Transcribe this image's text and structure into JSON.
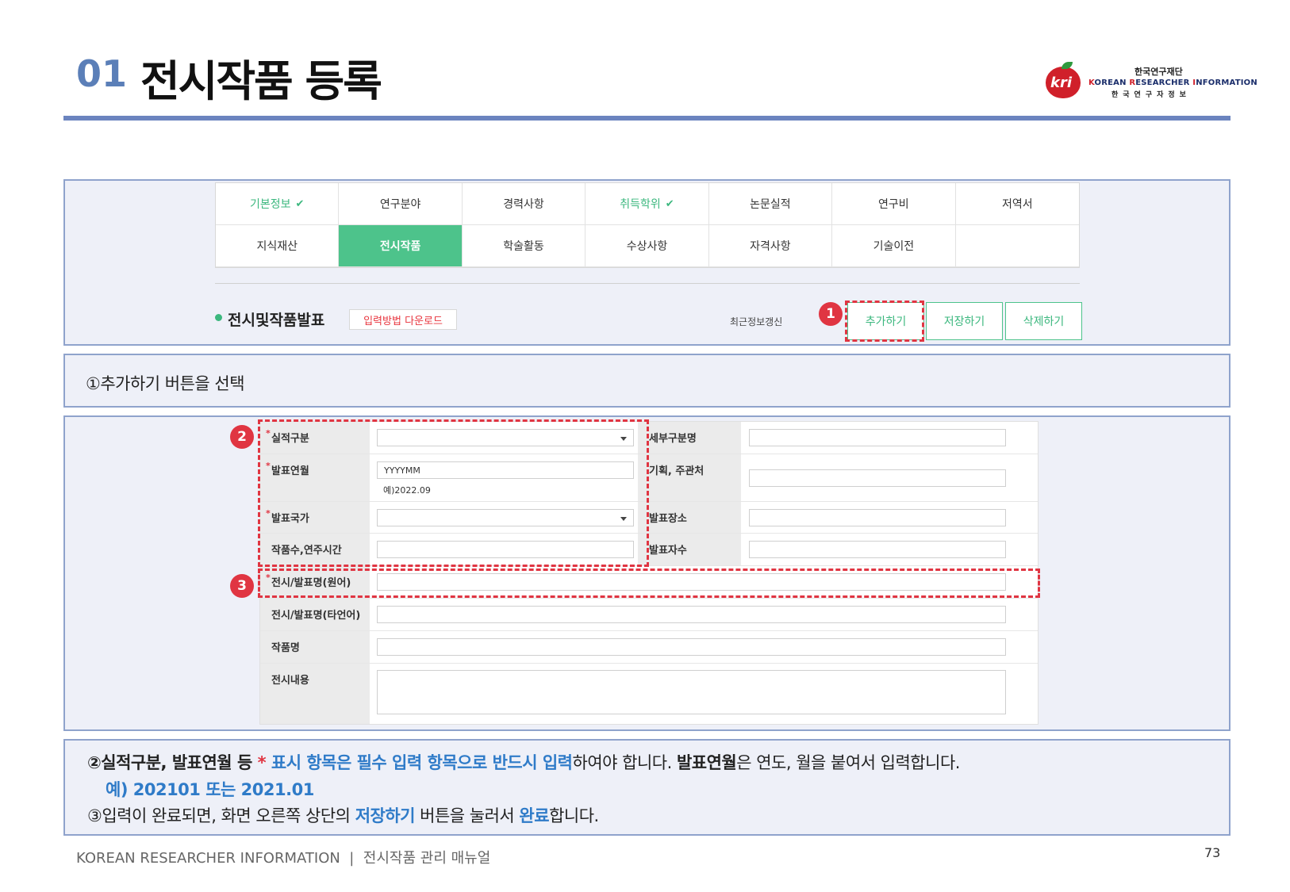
{
  "header": {
    "number": "01",
    "title": "전시작품 등록"
  },
  "logo": {
    "mark": "kri",
    "top_text": "한국연구재단",
    "english_prefix_k": "K",
    "english_rest_1": "OREAN ",
    "english_r": "R",
    "english_rest_2": "ESEARCHER ",
    "english_i": "I",
    "english_rest_3": "NFORMATION",
    "bottom_text": "한국연구자정보"
  },
  "tabs": [
    {
      "label": "기본정보",
      "check": "✔",
      "state": "done"
    },
    {
      "label": "연구분야",
      "check": "",
      "state": "normal"
    },
    {
      "label": "경력사항",
      "check": "",
      "state": "normal"
    },
    {
      "label": "취득학위",
      "check": "✔",
      "state": "done"
    },
    {
      "label": "논문실적",
      "check": "",
      "state": "normal"
    },
    {
      "label": "연구비",
      "check": "",
      "state": "normal"
    },
    {
      "label": "저역서",
      "check": "",
      "state": "normal"
    },
    {
      "label": "지식재산",
      "check": "",
      "state": "normal"
    },
    {
      "label": "전시작품",
      "check": "",
      "state": "active"
    },
    {
      "label": "학술활동",
      "check": "",
      "state": "normal"
    },
    {
      "label": "수상사항",
      "check": "",
      "state": "normal"
    },
    {
      "label": "자격사항",
      "check": "",
      "state": "normal"
    },
    {
      "label": "기술이전",
      "check": "",
      "state": "normal"
    },
    {
      "label": "",
      "check": "",
      "state": "normal"
    }
  ],
  "section": {
    "title": "전시및작품발표",
    "download_label": "입력방법 다운로드",
    "recent_label": "최근정보갱신",
    "add_label": "추가하기",
    "save_label": "저장하기",
    "delete_label": "삭제하기"
  },
  "markers": {
    "m1": "1",
    "m2": "2",
    "m3": "3"
  },
  "note1": "①추가하기 버튼을 선택",
  "form": {
    "required_mark": "*",
    "category_label": "실적구분",
    "subcategory_label": "세부구분명",
    "date_label": "발표연월",
    "date_placeholder": "YYYYMM",
    "date_hint": "예)2022.09",
    "organizer_label": "기획, 주관처",
    "country_label": "발표국가",
    "venue_label": "발표장소",
    "works_label": "작품수,연주시간",
    "count_label": "발표자수",
    "title_orig_label": "전시/발표명(원어)",
    "title_other_label": "전시/발표명(타언어)",
    "work_name_label": "작품명",
    "content_label": "전시내용"
  },
  "note2": {
    "prefix": "②실적구분, 발표연월 등 ",
    "star": "*",
    "highlight": " 표시 항목은 필수 입력 항목으로 반드시 입력",
    "middle": "하여야 합니다. ",
    "bold_term": "발표연월",
    "suffix": "은 연도, 월을 붙여서 입력합니다.",
    "example": "예) 202101 또는 2021.01"
  },
  "note3": {
    "prefix": "③입력이 완료되면, 화면 오른쪽 상단의 ",
    "save": "저장하기",
    "middle": " 버튼을 눌러서 ",
    "done": "완료",
    "suffix": "합니다."
  },
  "footer": {
    "text": "KOREAN RESEARCHER INFORMATION  |  전시작품 관리 매뉴얼",
    "page": "73"
  },
  "colors": {
    "accent_blue": "#5b7fb8",
    "green": "#3bb77e",
    "marker_red": "#e03542",
    "link_blue": "#2f7bc8"
  }
}
